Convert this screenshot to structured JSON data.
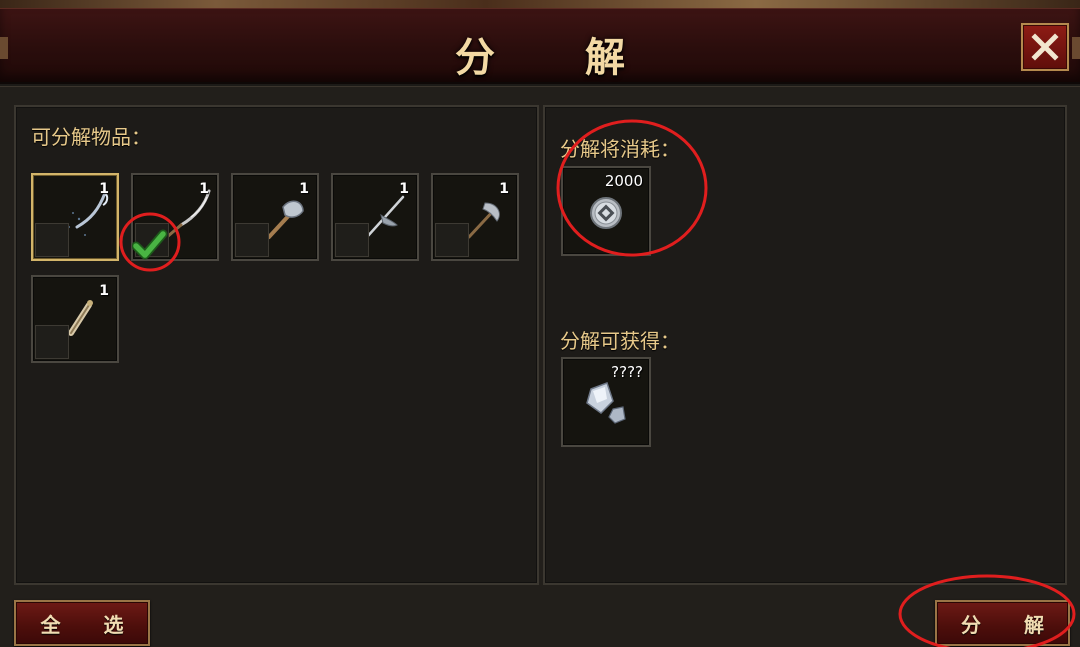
{
  "dialog": {
    "title": "分 解",
    "close_label": "✕"
  },
  "left_panel": {
    "label": "可分解物品：",
    "items": [
      {
        "icon": "halberd-icon",
        "count": "1",
        "selected": true
      },
      {
        "icon": "glaive-icon",
        "count": "1",
        "checked": true
      },
      {
        "icon": "axe-icon",
        "count": "1"
      },
      {
        "icon": "crossed-spear-icon",
        "count": "1"
      },
      {
        "icon": "crescent-blade-icon",
        "count": "1"
      },
      {
        "icon": "scroll-staff-icon",
        "count": "1"
      }
    ]
  },
  "right_panel": {
    "cost_label": "分解将消耗：",
    "cost_amount": "2000",
    "cost_icon": "silver-coin-icon",
    "gain_label": "分解可获得：",
    "gain_amount": "????",
    "gain_icon": "crystal-ore-icon"
  },
  "buttons": {
    "select_all": "全 选",
    "decompose": "分 解"
  },
  "colors": {
    "accent_gold": "#e7c98a",
    "title_bar": "#2a0d0c",
    "button_red": "#6e1a15",
    "annotation_red": "#e01e1e",
    "check_green": "#3fa53a"
  }
}
